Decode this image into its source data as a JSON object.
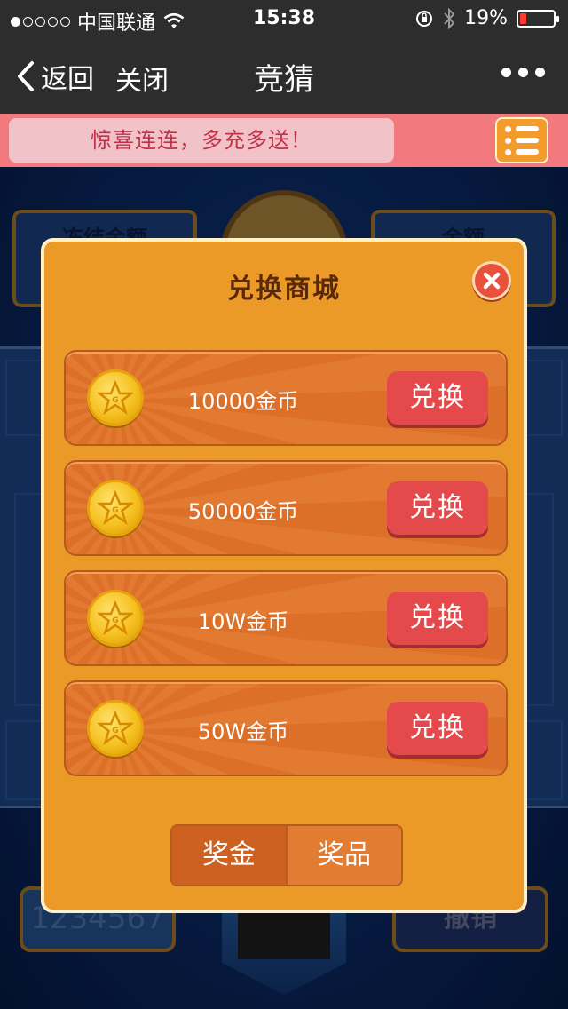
{
  "status_bar": {
    "carrier": "中国联通",
    "time": "15:38",
    "battery_percent": "19%",
    "battery_level": 0.19,
    "signal_dots": [
      true,
      false,
      false,
      false,
      false
    ]
  },
  "nav": {
    "back_label": "返回",
    "close_label": "关闭",
    "title": "竞猜"
  },
  "notice": {
    "text": "惊喜连连，多充多送！"
  },
  "background": {
    "left_panel_label": "冻结金额",
    "right_panel_label": "余额",
    "bottom_left_value": "1234567",
    "bottom_right_label": "撤销"
  },
  "modal": {
    "title": "兑换商城",
    "items": [
      {
        "amount_label": "10000金币",
        "button_label": "兑换"
      },
      {
        "amount_label": "50000金币",
        "button_label": "兑换"
      },
      {
        "amount_label": "10W金币",
        "button_label": "兑换"
      },
      {
        "amount_label": "50W金币",
        "button_label": "兑换"
      }
    ],
    "tabs": [
      {
        "label": "奖金",
        "active": true
      },
      {
        "label": "奖品",
        "active": false
      }
    ]
  },
  "colors": {
    "modal_bg": "#eb9a28",
    "exchange_button": "#e44a4c",
    "nav_bg": "#2d2d2d",
    "notice_bg": "#f27a7e"
  }
}
